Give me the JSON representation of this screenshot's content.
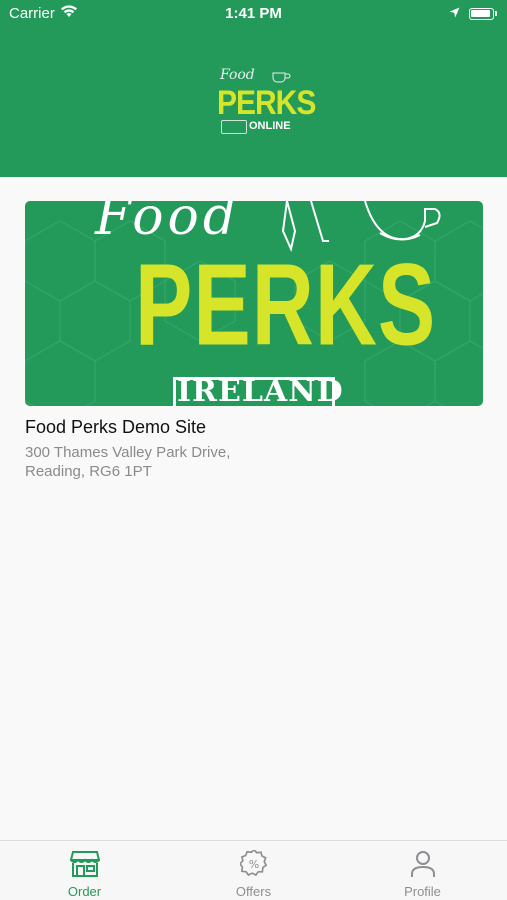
{
  "status_bar": {
    "carrier": "Carrier",
    "time": "1:41 PM"
  },
  "header": {
    "logo": {
      "food": "Food",
      "perks": "PERKS",
      "online": "ONLINE"
    }
  },
  "restaurants": [
    {
      "banner": {
        "food": "Food",
        "perks": "PERKS",
        "ireland": "IRELAND"
      },
      "name": "Food Perks Demo Site",
      "address": "300 Thames Valley Park Drive, Reading, RG6 1PT"
    }
  ],
  "tabs": [
    {
      "label": "Order",
      "icon": "store-icon",
      "active": true
    },
    {
      "label": "Offers",
      "icon": "offers-badge-icon",
      "active": false
    },
    {
      "label": "Profile",
      "icon": "person-icon",
      "active": false
    }
  ],
  "colors": {
    "brand_green": "#239a5a",
    "accent_yellow": "#d6e52a",
    "inactive": "#8e8e93"
  }
}
